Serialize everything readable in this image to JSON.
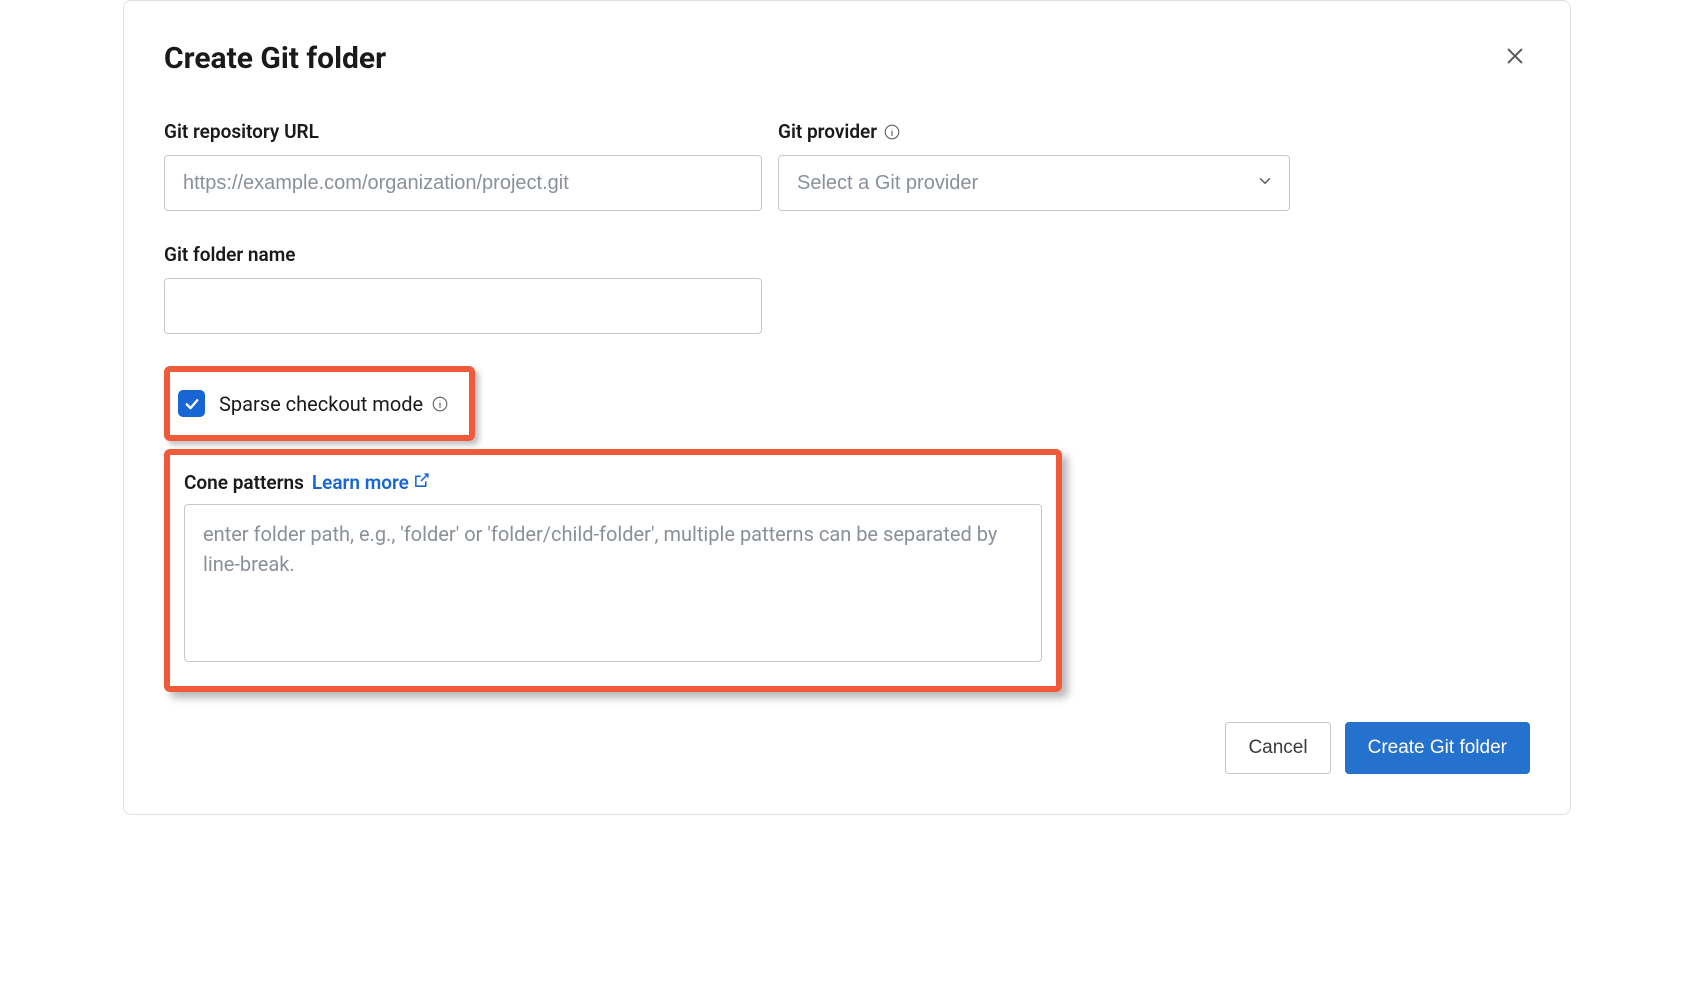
{
  "modal": {
    "title": "Create Git folder"
  },
  "form": {
    "repo_url": {
      "label": "Git repository URL",
      "placeholder": "https://example.com/organization/project.git",
      "value": ""
    },
    "provider": {
      "label": "Git provider",
      "placeholder": "Select a Git provider",
      "value": ""
    },
    "folder_name": {
      "label": "Git folder name",
      "value": ""
    },
    "sparse_checkout": {
      "label": "Sparse checkout mode",
      "checked": true
    },
    "cone_patterns": {
      "label": "Cone patterns",
      "learn_more": "Learn more",
      "placeholder": "enter folder path, e.g., 'folder' or 'folder/child-folder', multiple patterns can be separated by line-break.",
      "value": ""
    }
  },
  "footer": {
    "cancel": "Cancel",
    "submit": "Create Git folder"
  },
  "colors": {
    "primary": "#2571ce",
    "checkbox": "#1866d6",
    "highlight": "#ef5a3a",
    "link": "#1866d6"
  }
}
